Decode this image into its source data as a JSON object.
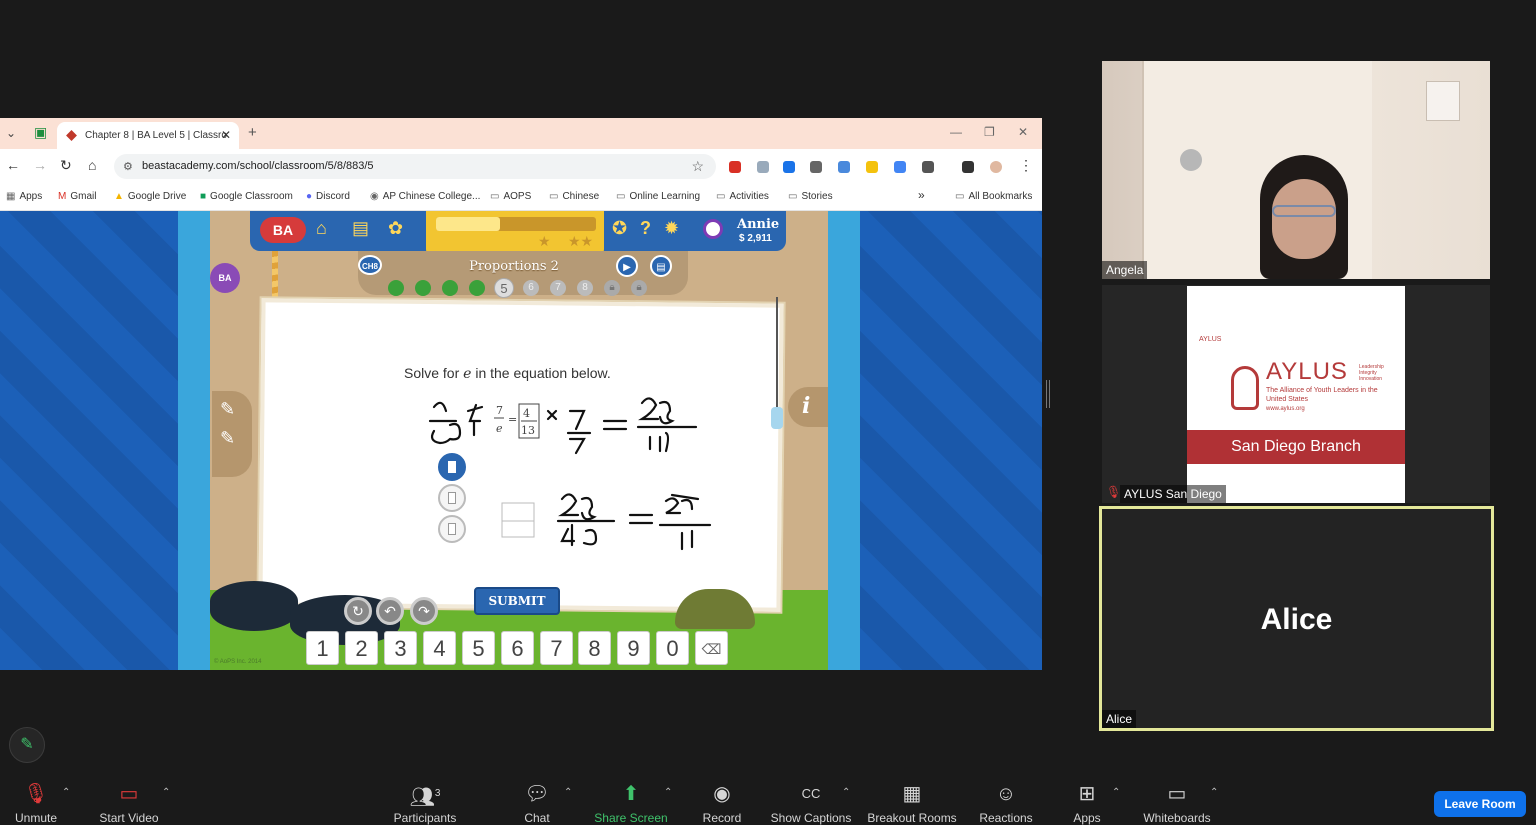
{
  "browser": {
    "tab_title": "Chapter 8 | BA Level 5 | Classro",
    "url": "beastacademy.com/school/classroom/5/8/883/5",
    "bookmarks": [
      "Apps",
      "Gmail",
      "Google Drive",
      "Google Classroom",
      "Discord",
      "AP Chinese College...",
      "AOPS",
      "Chinese",
      "Online Learning",
      "Activities",
      "Stories"
    ],
    "all_bookmarks": "All Bookmarks",
    "more": "»"
  },
  "game": {
    "user_name": "Annie",
    "coins": "$ 2,911",
    "ch_badge": "CH8",
    "lesson_title": "Proportions 2",
    "progress": [
      {
        "label": "1",
        "state": "done"
      },
      {
        "label": "2",
        "state": "done"
      },
      {
        "label": "3",
        "state": "done"
      },
      {
        "label": "4",
        "state": "done"
      },
      {
        "label": "5",
        "state": "cur"
      },
      {
        "label": "6",
        "state": "todo"
      },
      {
        "label": "7",
        "state": "todo"
      },
      {
        "label": "8",
        "state": "todo"
      }
    ],
    "prompt_pre": "Solve for",
    "prompt_var": "e",
    "prompt_post": "in the equation below.",
    "equation": {
      "left_num": "7",
      "left_den": "e",
      "right_num": "4",
      "right_den": "13"
    },
    "submit_label": "SUBMIT",
    "keypad": [
      "1",
      "2",
      "3",
      "4",
      "5",
      "6",
      "7",
      "8",
      "9",
      "0"
    ],
    "info_label": "i",
    "copyright": "© AoPS Inc. 2014"
  },
  "participants": {
    "angela": "Angela",
    "aylus": "AYLUS San Diego",
    "alice_label": "Alice",
    "alice_center": "Alice",
    "aylus_card": {
      "small": "AYLUS",
      "big": "AYLUS",
      "sub": "The Alliance of Youth Leaders in the United States",
      "url": "www.aylus.org",
      "banner": "San Diego Branch",
      "tagline": "Leadership Integrity Innovation"
    }
  },
  "zoom_toolbar": {
    "unmute": "Unmute",
    "start_video": "Start Video",
    "participants": "Participants",
    "participant_count": "3",
    "chat": "Chat",
    "share_screen": "Share Screen",
    "record": "Record",
    "show_captions": "Show Captions",
    "breakout_rooms": "Breakout Rooms",
    "reactions": "Reactions",
    "apps": "Apps",
    "whiteboards": "Whiteboards",
    "leave": "Leave Room"
  },
  "colors": {
    "zoom_bg": "#1a1a1a",
    "share_green": "#3fc26b",
    "leave_blue": "#0e71eb",
    "speaker_border": "#e4e89a",
    "game_blue": "#2a66b0"
  }
}
